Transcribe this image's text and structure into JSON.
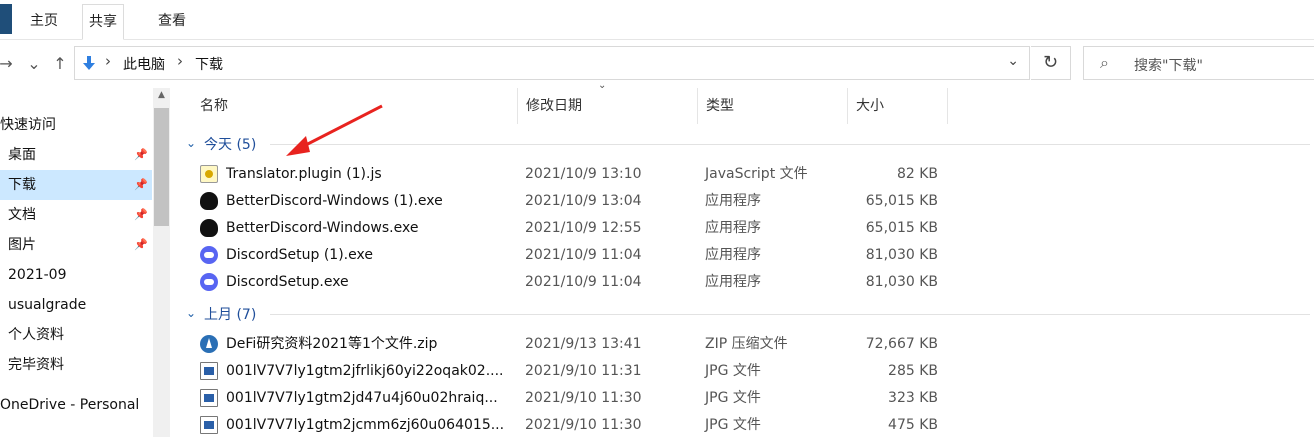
{
  "ribbon": {
    "tabs": [
      {
        "label": "主页"
      },
      {
        "label": "共享"
      },
      {
        "label": "查看"
      }
    ]
  },
  "nav": {
    "back_glyph": "→",
    "recent_glyph": "⌄",
    "up_glyph": "↑",
    "breadcrumb": [
      "此电脑",
      "下载"
    ],
    "chevron_glyph": "⌄",
    "refresh_glyph": "↻",
    "search_icon": "⌕",
    "search_placeholder": "搜索\"下载\""
  },
  "sidebar": {
    "items": [
      {
        "label": "快速访问",
        "pinned": false
      },
      {
        "label": "桌面",
        "pinned": true
      },
      {
        "label": "下载",
        "pinned": true
      },
      {
        "label": "文档",
        "pinned": true
      },
      {
        "label": "图片",
        "pinned": true
      },
      {
        "label": "2021-09",
        "pinned": false
      },
      {
        "label": "usualgrade",
        "pinned": false
      },
      {
        "label": "个人资料",
        "pinned": false
      },
      {
        "label": "完毕资料",
        "pinned": false
      },
      {
        "label": "OneDrive - Personal",
        "pinned": false
      }
    ],
    "pin_glyph": "📌"
  },
  "columns": {
    "name": "名称",
    "date": "修改日期",
    "type": "类型",
    "size": "大小"
  },
  "groups": [
    {
      "label": "今天 (5)",
      "files": [
        {
          "name": "Translator.plugin (1).js",
          "date": "2021/10/9 13:10",
          "type": "JavaScript 文件",
          "size": "82 KB",
          "icon": "js-file-icon"
        },
        {
          "name": "BetterDiscord-Windows (1).exe",
          "date": "2021/10/9 13:04",
          "type": "应用程序",
          "size": "65,015 KB",
          "icon": "betterdiscord-icon"
        },
        {
          "name": "BetterDiscord-Windows.exe",
          "date": "2021/10/9 12:55",
          "type": "应用程序",
          "size": "65,015 KB",
          "icon": "betterdiscord-icon"
        },
        {
          "name": "DiscordSetup (1).exe",
          "date": "2021/10/9 11:04",
          "type": "应用程序",
          "size": "81,030 KB",
          "icon": "discord-icon"
        },
        {
          "name": "DiscordSetup.exe",
          "date": "2021/10/9 11:04",
          "type": "应用程序",
          "size": "81,030 KB",
          "icon": "discord-icon"
        }
      ]
    },
    {
      "label": "上月 (7)",
      "files": [
        {
          "name": "DeFi研究资料2021等1个文件.zip",
          "date": "2021/9/13 13:41",
          "type": "ZIP 压缩文件",
          "size": "72,667 KB",
          "icon": "zip-icon"
        },
        {
          "name": "001lV7V7ly1gtm2jfrlikj60yi22oqak02....",
          "date": "2021/9/10 11:31",
          "type": "JPG 文件",
          "size": "285 KB",
          "icon": "jpg-file-icon"
        },
        {
          "name": "001lV7V7ly1gtm2jd47u4j60u02hraiq...",
          "date": "2021/9/10 11:30",
          "type": "JPG 文件",
          "size": "323 KB",
          "icon": "jpg-file-icon"
        },
        {
          "name": "001lV7V7ly1gtm2jcmm6zj60u064015...",
          "date": "2021/9/10 11:30",
          "type": "JPG 文件",
          "size": "475 KB",
          "icon": "jpg-file-icon"
        }
      ]
    }
  ],
  "colors": {
    "selected_bg": "#cce8ff",
    "group_label": "#1f4e9a",
    "annotation_arrow": "#e8231f"
  }
}
